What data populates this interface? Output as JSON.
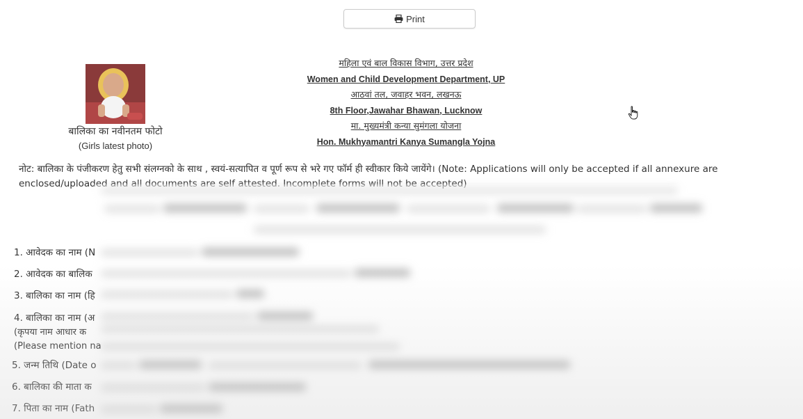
{
  "toolbar": {
    "print_label": "Print",
    "print_icon": "printer-icon"
  },
  "photo": {
    "caption_hi": "बालिका का नवीनतम फोटो",
    "caption_en": "(Girls latest photo)"
  },
  "header": {
    "line1": "महिला एवं बाल विकास विभाग, उत्तर प्रदेश",
    "line2": "Women and Child Development Department, UP",
    "line3": "आठवां तल, जवाहर भवन, लखनऊ",
    "line4": "8th Floor,Jawahar Bhawan, Lucknow",
    "line5": "मा. मुख्यमंत्री कन्या सुमंगला योजना",
    "line6": "Hon. Mukhyamantri Kanya Sumangla Yojna"
  },
  "note": {
    "text": "नोट: बालिका के पंजीकरण हेतु सभी संलग्नको के साथ , स्वयं-सत्यापित व पूर्ण रूप से भरे गए फॉर्म ही स्वीकार किये जायेंगे। (Note: Applications will only be accepted if all annexure are enclosed/uploaded and all documents are self attested. Incomplete forms will not be accepted)"
  },
  "questions": [
    "1. आवेदक का नाम (N",
    "2. आवेदक का बालिक",
    "3. बालिका का नाम (हि",
    "4. बालिका का नाम (अ",
    "(कृपया नाम आधार क",
    "(Please mention na",
    "5. जन्म तिथि (Date o",
    "6. बालिका की माता क",
    "7. पिता का नाम (Fath"
  ]
}
